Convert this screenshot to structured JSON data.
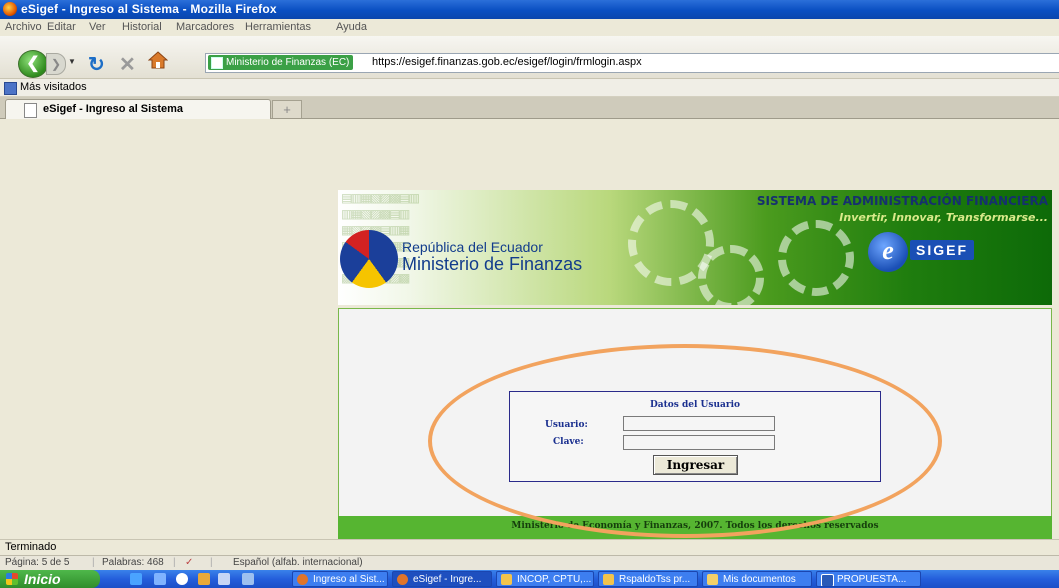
{
  "window": {
    "title": "eSigef - Ingreso al Sistema - Mozilla Firefox"
  },
  "menu": [
    "Archivo",
    "Editar",
    "Ver",
    "Historial",
    "Marcadores",
    "Herramientas",
    "Ayuda"
  ],
  "nav": {
    "site_identity": "Ministerio de Finanzas (EC)",
    "url": "https://esigef.finanzas.gob.ec/esigef/login/frmlogin.aspx"
  },
  "bookmarks": {
    "most_visited": "Más visitados"
  },
  "tabs": [
    {
      "label": "eSigef - Ingreso al Sistema"
    }
  ],
  "newtab_symbol": "+",
  "banner": {
    "system_name": "SISTEMA DE ADMINISTRACIÓN FINANCIERA",
    "slogan": "Invertir, Innovar, Transformarse...",
    "republic": "República del Ecuador",
    "ministry": "Ministerio de Finanzas",
    "logo_e": "e",
    "logo_text": "SIGEF"
  },
  "login": {
    "header": "Datos del Usuario",
    "user_label": "Usuario:",
    "user_value": "",
    "password_label": "Clave:",
    "password_value": "",
    "submit_label": "Ingresar"
  },
  "footer": {
    "text": "Ministerio de Economía y Finanzas, 2007. Todos los derechos reservados"
  },
  "status": {
    "text": "Terminado"
  },
  "word_status": {
    "page": "Página: 5 de 5",
    "words": "Palabras: 468",
    "language": "Español (alfab. internacional)"
  },
  "taskbar": {
    "start_label": "Inicio",
    "buttons": [
      {
        "label": "Ingreso al Sist...",
        "color": "#e0742a"
      },
      {
        "label": "eSigef - Ingre...",
        "color": "#e0742a"
      },
      {
        "label": "INCOP, CPTU,...",
        "color": "#f2c34c"
      },
      {
        "label": "RspaldoTss pr...",
        "color": "#f2c34c"
      },
      {
        "label": "Mis documentos",
        "color": "#f2d069"
      },
      {
        "label": "PROPUESTA...",
        "color": "#2a5ab8"
      }
    ]
  },
  "annotation_color": "#f2a35e"
}
